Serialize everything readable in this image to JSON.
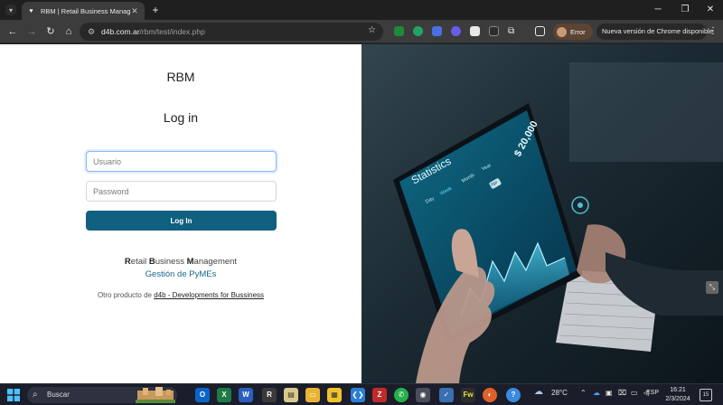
{
  "browser": {
    "tab_title": "RBM | Retail Business Managem",
    "url_host": "d4b.com.ar",
    "url_path": "/rbm/test/index.php",
    "profile_label": "Error",
    "update_label": "Nueva versión de Chrome disponible"
  },
  "login": {
    "brand": "RBM",
    "title": "Log in",
    "username_placeholder": "Usuario",
    "password_placeholder": "Password",
    "submit_label": "Log In"
  },
  "tagline": {
    "r": "R",
    "r_rest": "etail ",
    "b": "B",
    "b_rest": "usiness ",
    "m": "M",
    "m_rest": "anagement",
    "line2": "Gestión de PyMEs"
  },
  "footer": {
    "prefix": "Otro producto de ",
    "link": "d4b - Developments for Bussiness"
  },
  "hero": {
    "screen_title": "Statistics",
    "screen_amount": "$ 20,000",
    "period_tabs": [
      "Day",
      "Week",
      "Month",
      "Year"
    ],
    "selected_month": "Apr"
  },
  "taskbar": {
    "search_label": "Buscar",
    "weather": "28°C",
    "language": "ESP",
    "time": "16:21",
    "date": "2/3/2024",
    "notif_count": "15"
  },
  "colors": {
    "accent_button": "#10607f",
    "tagline_blue": "#1a6a8a",
    "chrome_dark": "#3c3c3c"
  }
}
